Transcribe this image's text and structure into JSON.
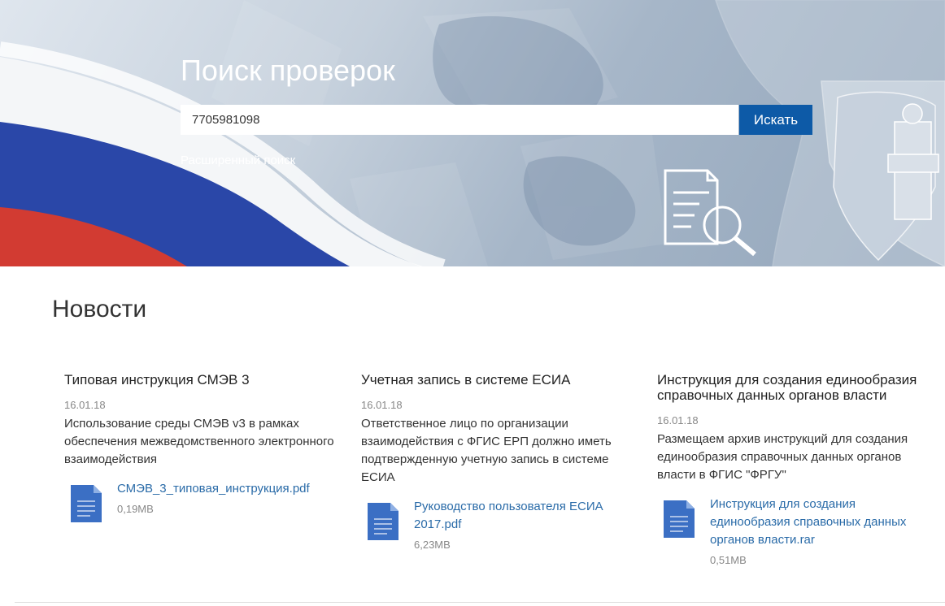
{
  "hero": {
    "title": "Поиск проверок",
    "search_value": "7705981098",
    "search_button": "Искать",
    "advanced_link": "Расширенный поиск"
  },
  "news": {
    "title": "Новости",
    "items": [
      {
        "title": "Типовая инструкция СМЭВ 3",
        "date": "16.01.18",
        "description": "Использование среды СМЭВ v3 в рамках обеспечения межведомственного электронного взаимодействия",
        "file_name": "СМЭВ_3_типовая_инструкция.pdf",
        "file_size": "0,19MB"
      },
      {
        "title": "Учетная запись в системе ЕСИА",
        "date": "16.01.18",
        "description": "Ответственное лицо по организации взаимодействия с ФГИС ЕРП должно иметь подтвержденную учетную запись в системе ЕСИА",
        "file_name": "Руководство пользователя ЕСИА 2017.pdf",
        "file_size": "6,23MB"
      },
      {
        "title": "Инструкция для создания единообразия справочных данных органов власти",
        "date": "16.01.18",
        "description": "Размещаем архив инструкций для создания единообразия справочных данных органов власти в ФГИС \"ФРГУ\"",
        "file_name": "Инструкция для создания единообразия справочных данных органов власти.rar",
        "file_size": "0,51MB"
      }
    ]
  },
  "colors": {
    "accent": "#0d5aa7",
    "link": "#2a6ba8",
    "file_icon": "#3b6fc4"
  },
  "icons": {
    "flag": "russian-flag-icon",
    "emblem": "prosecutor-emblem-icon",
    "document_search": "document-search-icon",
    "file": "document-file-icon"
  }
}
